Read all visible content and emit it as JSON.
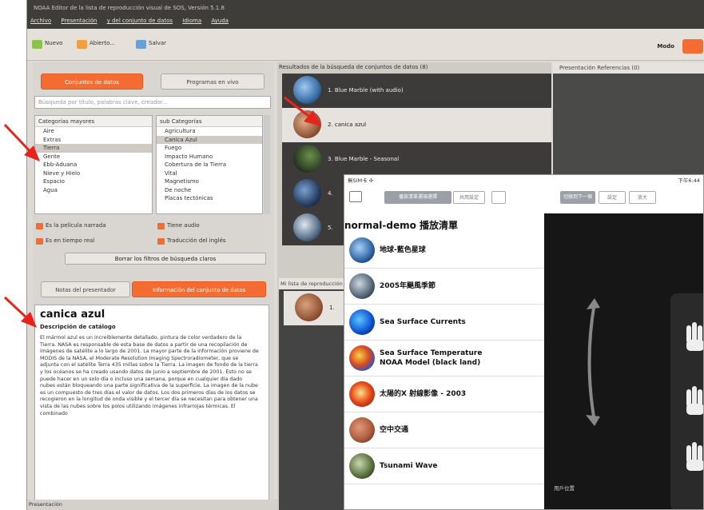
{
  "window": {
    "title": "NOAA Editor de la lista de reproducción visual de SOS, Versión 5.1.8",
    "menu": [
      "Archivo",
      "Presentación",
      "y del conjunto de datos",
      "Idioma",
      "Ayuda"
    ]
  },
  "toolbar": {
    "new": "Nuevo",
    "open": "Abierto...",
    "save": "Salvar",
    "mode": "Modo"
  },
  "left": {
    "tab_datasets": "Conjuntos de datos",
    "tab_programs": "Programas en vivo",
    "search_placeholder": "Búsqueda por título, palabras clave, creador...",
    "major_header": "Categorías mayores",
    "major": [
      "Aire",
      "Extras",
      "Tierra",
      "Gente",
      "Ebb-Aduana",
      "Nieve y Hielo",
      "Espacio",
      "Agua"
    ],
    "major_selected": 2,
    "sub_header": "sub Categorías",
    "sub": [
      "Agricultura",
      "Canica Azul",
      "Fuego",
      "Impacto Humano",
      "Cobertura de la Tierra",
      "Vital",
      "Magnetismo",
      "De noche",
      "Placas tectónicas"
    ],
    "sub_selected": 1,
    "filters": [
      "Es la película narrada",
      "Tiene audio",
      "Es en tiempo real",
      "Traducción del inglés"
    ],
    "clear_filters": "Borrar los filtros de búsqueda claros",
    "tab_notes": "Notas del presentador",
    "tab_info": "Información del conjunto de datos",
    "detail_title": "canica azul",
    "detail_subtitle": "Descripción de catálogo",
    "detail_body": "El mármol azul es un increíblemente detallado, pintura de color verdadero de la Tierra. NASA es responsable de esta base de datos a partir de una recopilación de imágenes de satélite a lo largo de 2001. La mayor parte de la información proviene de MODIS de la NASA, el Moderate Resolution Imaging Spectroradiometer, que se adjunta con el satélite Terra 435 millas sobre la Tierra. La imagen de fondo de la tierra y los océanos se ha creado usando datos de junio a septiembre de 2001. Esto no se puede hacer en un solo día o incluso una semana, porque en cualquier día dado nubes están bloqueando una parte significativa de la superficie. La imagen de la nube es un compuesto de tres días el valor de datos. Los dos primeros días de los datos se recogieron en la longitud de onda visible y el tercer día se necesitan para obtener una vista de las nubes sobre los polos utilizando imágenes infrarrojas térmicas. El combinado",
    "status": "Presentación"
  },
  "middle": {
    "header": "Resultados de la búsqueda de conjuntos de datos (8)",
    "results": [
      "1. Blue Marble (with audio)",
      "2. canica azul",
      "3. Blue Marble - Seasonal",
      "4.",
      "5."
    ],
    "selected": 1,
    "playlist_header": "Mi lista de reproducción",
    "playlist_item": "1."
  },
  "right": {
    "header": "Presentación Referencias (0)"
  },
  "ipad": {
    "carrier": "無SIM卡 ✣",
    "time": "下午6:44",
    "btn1": "播放清單選項選擇",
    "btn2": "共用設定",
    "btn3": "切換到下一個",
    "btn4": "設定",
    "btn5": "放大",
    "playlist_title": "normal-demo 播放清單",
    "items": [
      "地球-藍色星球",
      "2005年颶風季節",
      "Sea Surface Currents",
      "Sea Surface Temperature\nNOAA Model (black land)",
      "太陽的X 射線影像 - 2003",
      "空中交通",
      "Tsunami Wave"
    ],
    "position_label": "用戶位置"
  },
  "colors": {
    "accent": "#f46c31",
    "annotation_arrow": "#e8231c"
  }
}
